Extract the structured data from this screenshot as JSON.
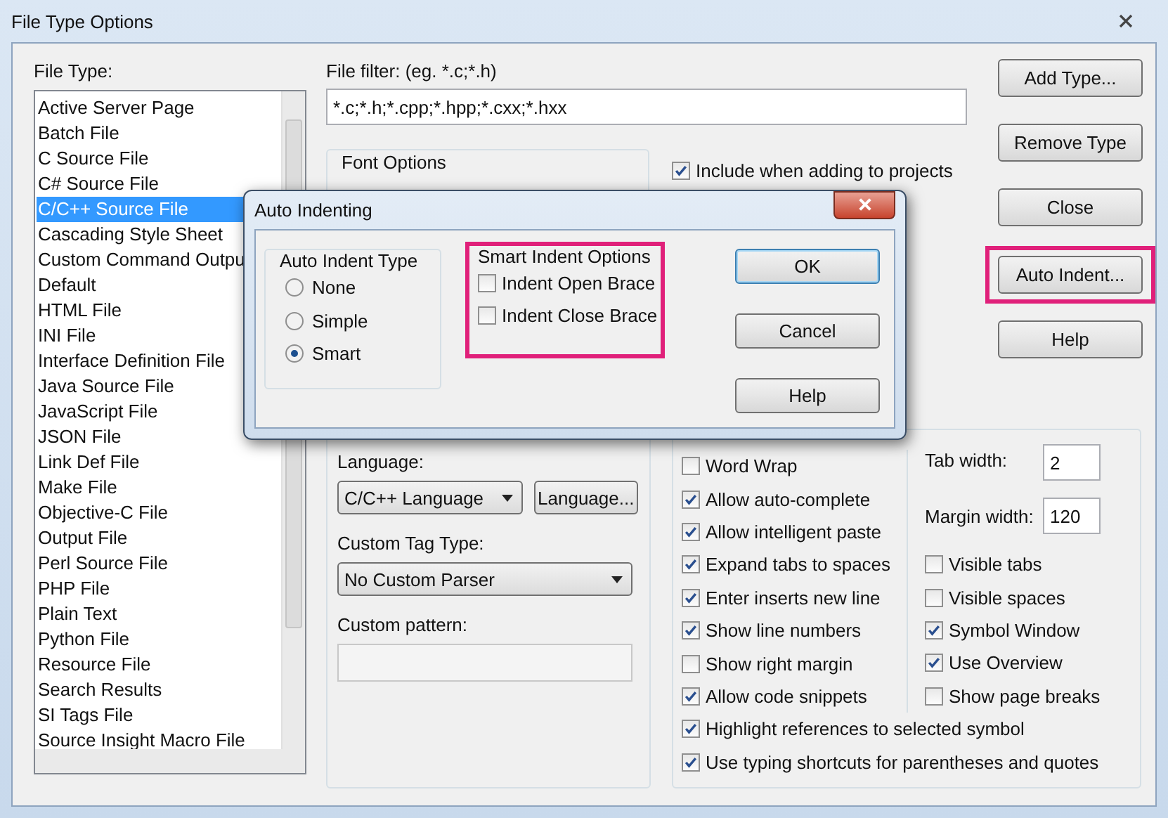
{
  "window": {
    "title": "File Type Options"
  },
  "file_type": {
    "label": "File Type:",
    "items": [
      {
        "label": "Active Server Page",
        "selected": false
      },
      {
        "label": "Batch File",
        "selected": false
      },
      {
        "label": "C Source File",
        "selected": false
      },
      {
        "label": "C# Source File",
        "selected": false
      },
      {
        "label": "C/C++ Source File",
        "selected": true
      },
      {
        "label": "Cascading Style Sheet",
        "selected": false
      },
      {
        "label": "Custom Command Outpu",
        "selected": false
      },
      {
        "label": "Default",
        "selected": false
      },
      {
        "label": "HTML File",
        "selected": false
      },
      {
        "label": "INI File",
        "selected": false
      },
      {
        "label": "Interface Definition File",
        "selected": false
      },
      {
        "label": "Java Source File",
        "selected": false
      },
      {
        "label": "JavaScript File",
        "selected": false
      },
      {
        "label": "JSON File",
        "selected": false
      },
      {
        "label": "Link Def File",
        "selected": false
      },
      {
        "label": "Make File",
        "selected": false
      },
      {
        "label": "Objective-C File",
        "selected": false
      },
      {
        "label": "Output File",
        "selected": false
      },
      {
        "label": "Perl Source File",
        "selected": false
      },
      {
        "label": "PHP File",
        "selected": false
      },
      {
        "label": "Plain Text",
        "selected": false
      },
      {
        "label": "Python File",
        "selected": false
      },
      {
        "label": "Resource File",
        "selected": false
      },
      {
        "label": "Search Results",
        "selected": false
      },
      {
        "label": "SI Tags File",
        "selected": false
      },
      {
        "label": "Source Insight Macro File",
        "selected": false
      }
    ]
  },
  "file_filter": {
    "label": "File filter: (eg. *.c;*.h)",
    "value": "*.c;*.h;*.cpp;*.hpp;*.cxx;*.hxx"
  },
  "font_options": {
    "title": "Font Options"
  },
  "include_in_projects": {
    "label": "Include when adding to projects",
    "checked": true
  },
  "buttons": [
    {
      "label": "Add Type...",
      "highlighted": false
    },
    {
      "label": "Remove Type",
      "highlighted": false
    },
    {
      "label": "Close",
      "highlighted": false
    },
    {
      "label": "Auto Indent...",
      "highlighted": true
    },
    {
      "label": "Help",
      "highlighted": false
    }
  ],
  "language": {
    "label": "Language:",
    "value": "C/C++ Language",
    "button": "Language..."
  },
  "custom_tag_type": {
    "label": "Custom Tag Type:",
    "value": "No Custom Parser"
  },
  "custom_pattern": {
    "label": "Custom pattern:"
  },
  "editing_options": {
    "left": [
      {
        "label": "Word Wrap",
        "checked": false
      },
      {
        "label": "Allow auto-complete",
        "checked": true
      },
      {
        "label": "Allow intelligent paste",
        "checked": true
      },
      {
        "label": "Expand tabs to spaces",
        "checked": true
      },
      {
        "label": "Enter inserts new line",
        "checked": true
      },
      {
        "label": "Show line numbers",
        "checked": true
      },
      {
        "label": "Show right margin",
        "checked": false
      },
      {
        "label": "Allow code snippets",
        "checked": true
      }
    ],
    "fields": [
      {
        "label": "Tab width:",
        "value": "2"
      },
      {
        "label": "Margin width:",
        "value": "120"
      }
    ],
    "right": [
      {
        "label": "Visible tabs",
        "checked": false
      },
      {
        "label": "Visible spaces",
        "checked": false
      },
      {
        "label": "Symbol Window",
        "checked": true
      },
      {
        "label": "Use Overview",
        "checked": true
      },
      {
        "label": "Show page breaks",
        "checked": false
      }
    ],
    "wide": [
      {
        "label": "Highlight references to selected symbol",
        "checked": true
      },
      {
        "label": "Use typing shortcuts for parentheses and quotes",
        "checked": true
      }
    ]
  },
  "auto_indent_dialog": {
    "title": "Auto Indenting",
    "indent_type": {
      "title": "Auto Indent Type",
      "options": [
        {
          "label": "None",
          "selected": false
        },
        {
          "label": "Simple",
          "selected": false
        },
        {
          "label": "Smart",
          "selected": true
        }
      ]
    },
    "smart_options": {
      "title": "Smart Indent Options",
      "highlighted": true,
      "options": [
        {
          "label": "Indent Open Brace",
          "checked": false
        },
        {
          "label": "Indent Close Brace",
          "checked": false
        }
      ]
    },
    "buttons": [
      {
        "label": "OK",
        "default": true
      },
      {
        "label": "Cancel",
        "default": false
      },
      {
        "label": "Help",
        "default": false
      }
    ]
  }
}
